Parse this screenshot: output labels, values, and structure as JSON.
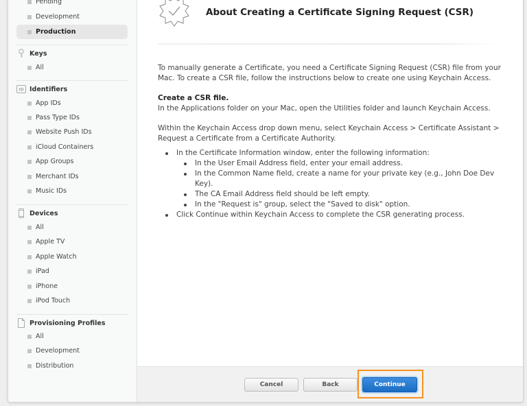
{
  "sidebar": {
    "certificates_items": [
      {
        "label": "Pending",
        "active": false
      },
      {
        "label": "Development",
        "active": false
      },
      {
        "label": "Production",
        "active": true
      }
    ],
    "sections": [
      {
        "heading": "Keys",
        "icon": "key-icon",
        "items": [
          "All"
        ]
      },
      {
        "heading": "Identifiers",
        "icon": "id-icon",
        "items": [
          "App IDs",
          "Pass Type IDs",
          "Website Push IDs",
          "iCloud Containers",
          "App Groups",
          "Merchant IDs",
          "Music IDs"
        ]
      },
      {
        "heading": "Devices",
        "icon": "device-icon",
        "items": [
          "All",
          "Apple TV",
          "Apple Watch",
          "iPad",
          "iPhone",
          "iPod Touch"
        ]
      },
      {
        "heading": "Provisioning Profiles",
        "icon": "document-icon",
        "items": [
          "All",
          "Development",
          "Distribution"
        ]
      }
    ]
  },
  "main": {
    "title": "About Creating a Certificate Signing Request (CSR)",
    "intro": "To manually generate a Certificate, you need a Certificate Signing Request (CSR) file from your Mac. To create a CSR file, follow the instructions below to create one using Keychain Access.",
    "subheading": "Create a CSR file.",
    "step1": "In the Applications folder on your Mac, open the Utilities folder and launch Keychain Access.",
    "step2": "Within the Keychain Access drop down menu, select Keychain Access > Certificate Assistant > Request a Certificate from a Certificate Authority.",
    "bullets": [
      {
        "text": "In the Certificate Information window, enter the following information:",
        "sub": [
          "In the User Email Address field, enter your email address.",
          "In the Common Name field, create a name for your private key (e.g., John Doe Dev Key).",
          "The CA Email Address field should be left empty.",
          "In the \"Request is\" group, select the \"Saved to disk\" option."
        ]
      },
      {
        "text": "Click Continue within Keychain Access to complete the CSR generating process.",
        "sub": []
      }
    ]
  },
  "footer": {
    "cancel_label": "Cancel",
    "back_label": "Back",
    "continue_label": "Continue"
  },
  "colors": {
    "primary_button": "#1a6cc4",
    "focus_highlight": "#f6921e"
  }
}
